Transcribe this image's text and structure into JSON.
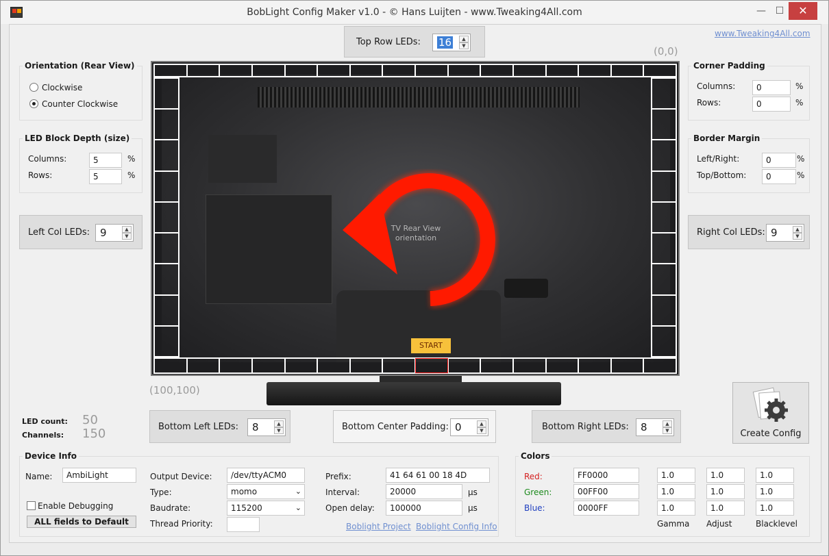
{
  "window": {
    "title": "BobLight Config Maker v1.0 - © Hans Luijten - www.Tweaking4All.com",
    "minimize": "—",
    "maximize": "☐",
    "close": "✕"
  },
  "link_top": "www.Tweaking4All.com",
  "top_row": {
    "label": "Top Row LEDs:",
    "value": "16"
  },
  "orientation": {
    "title": "Orientation (Rear View)",
    "opt1": "Clockwise",
    "opt2": "Counter Clockwise",
    "selected": "Counter Clockwise"
  },
  "led_block": {
    "title": "LED Block Depth (size)",
    "columns_label": "Columns:",
    "columns": "5",
    "rows_label": "Rows:",
    "rows": "5",
    "unit": "%"
  },
  "left_col": {
    "label": "Left Col LEDs:",
    "value": "9"
  },
  "corner_padding": {
    "title": "Corner Padding",
    "columns_label": "Columns:",
    "columns": "0",
    "rows_label": "Rows:",
    "rows": "0",
    "unit": "%"
  },
  "border_margin": {
    "title": "Border Margin",
    "lr_label": "Left/Right:",
    "lr": "0",
    "tb_label": "Top/Bottom:",
    "tb": "0",
    "unit": "%"
  },
  "right_col": {
    "label": "Right Col LEDs:",
    "value": "9"
  },
  "coords": {
    "top_right": "(0,0)",
    "bottom_left": "(100,100)"
  },
  "tv": {
    "caption": "TV Rear View orientation",
    "start": "START",
    "top_leds": 16,
    "side_leds": 9,
    "bottom_leds": 16,
    "bottom_start_index": 8
  },
  "stats": {
    "led_count_label": "LED count:",
    "led_count": "50",
    "channels_label": "Channels:",
    "channels": "150"
  },
  "bottom_left": {
    "label": "Bottom Left LEDs:",
    "value": "8"
  },
  "bottom_center": {
    "label": "Bottom Center Padding:",
    "value": "0"
  },
  "bottom_right": {
    "label": "Bottom Right LEDs:",
    "value": "8"
  },
  "create_config": "Create Config",
  "device": {
    "title": "Device Info",
    "name_label": "Name:",
    "name": "AmbiLight",
    "debug_label": "Enable Debugging",
    "default_button": "ALL fields to Default",
    "output_label": "Output Device:",
    "output": "/dev/ttyACM0",
    "type_label": "Type:",
    "type": "momo",
    "baud_label": "Baudrate:",
    "baud": "115200",
    "thread_label": "Thread Priority:",
    "thread": "",
    "prefix_label": "Prefix:",
    "prefix": "41 64 61 00 18 4D",
    "interval_label": "Interval:",
    "interval": "20000",
    "interval_unit": "µs",
    "delay_label": "Open delay:",
    "delay": "100000",
    "delay_unit": "µs",
    "link1": "Boblight Project",
    "link2": "Boblight Config Info"
  },
  "colors": {
    "title": "Colors",
    "red_label": "Red:",
    "red": "FF0000",
    "green_label": "Green:",
    "green": "00FF00",
    "blue_label": "Blue:",
    "blue": "0000FF",
    "gamma_label": "Gamma",
    "adjust_label": "Adjust",
    "black_label": "Blacklevel",
    "rows": [
      {
        "gamma": "1.0",
        "adjust": "1.0",
        "black": "1.0"
      },
      {
        "gamma": "1.0",
        "adjust": "1.0",
        "black": "1.0"
      },
      {
        "gamma": "1.0",
        "adjust": "1.0",
        "black": "1.0"
      }
    ],
    "red_color": "#d42020",
    "green_color": "#1d8a1d",
    "blue_color": "#2040c0"
  }
}
